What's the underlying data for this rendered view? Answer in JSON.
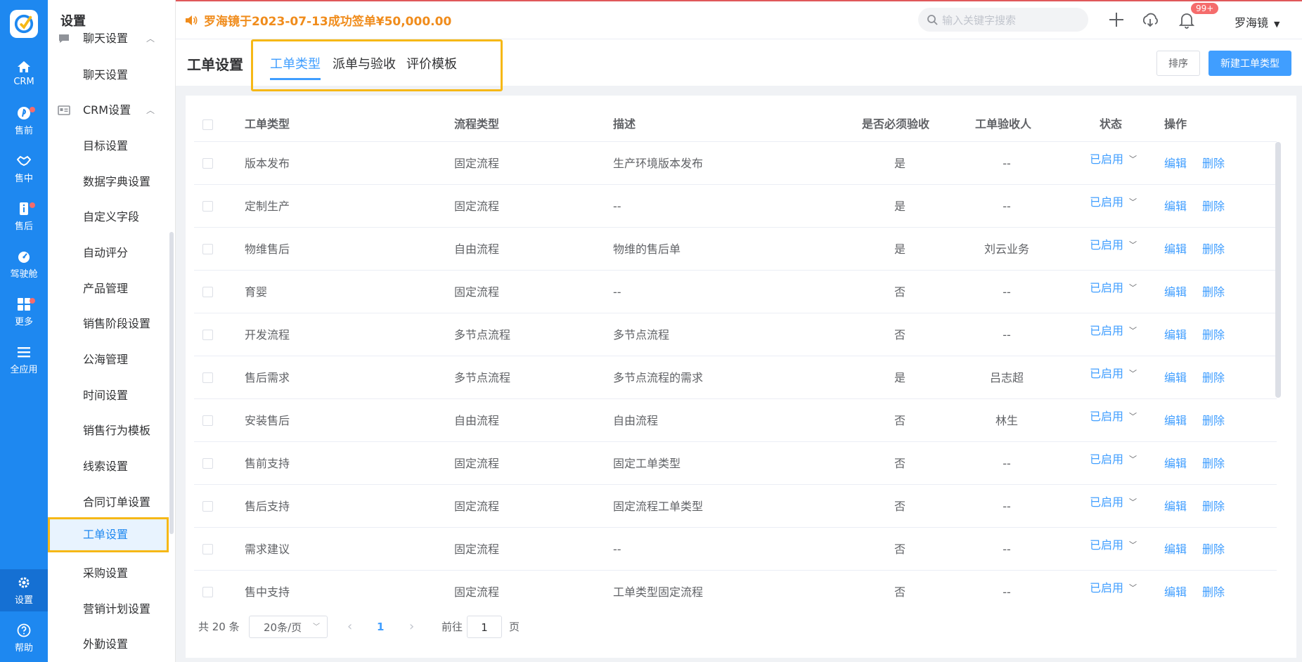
{
  "rail": {
    "items": [
      {
        "label": "CRM",
        "icon": "home-icon"
      },
      {
        "label": "售前",
        "icon": "pin-icon"
      },
      {
        "label": "售中",
        "icon": "handshake-icon"
      },
      {
        "label": "售后",
        "icon": "info-icon"
      },
      {
        "label": "驾驶舱",
        "icon": "dashboard-icon"
      },
      {
        "label": "更多",
        "icon": "grid-icon"
      },
      {
        "label": "全应用",
        "icon": "menu-icon"
      },
      {
        "label": "设置",
        "icon": "gear-icon"
      },
      {
        "label": "帮助",
        "icon": "help-icon"
      }
    ]
  },
  "sidebar": {
    "title": "设置",
    "items": [
      {
        "label": "聊天设置",
        "type": "group"
      },
      {
        "label": "聊天设置"
      },
      {
        "label": "CRM设置",
        "type": "group"
      },
      {
        "label": "目标设置"
      },
      {
        "label": "数据字典设置"
      },
      {
        "label": "自定义字段"
      },
      {
        "label": "自动评分"
      },
      {
        "label": "产品管理"
      },
      {
        "label": "销售阶段设置"
      },
      {
        "label": "公海管理"
      },
      {
        "label": "时间设置"
      },
      {
        "label": "销售行为模板"
      },
      {
        "label": "线索设置"
      },
      {
        "label": "合同订单设置"
      },
      {
        "label": "工单设置",
        "active": true
      },
      {
        "label": "采购设置"
      },
      {
        "label": "营销计划设置"
      },
      {
        "label": "外勤设置"
      }
    ]
  },
  "topbar": {
    "notice": "罗海镜于2023-07-13成功签单¥50,000.00",
    "search_placeholder": "输入关键字搜索",
    "badge": "99+",
    "user": "罗海镜"
  },
  "page": {
    "title": "工单设置",
    "tabs": [
      "工单类型",
      "派单与验收",
      "评价模板"
    ],
    "sort_label": "排序",
    "new_label": "新建工单类型"
  },
  "table": {
    "headers": [
      "工单类型",
      "流程类型",
      "描述",
      "是否必须验收",
      "工单验收人",
      "状态",
      "操作"
    ],
    "edit_label": "编辑",
    "delete_label": "删除",
    "rows": [
      {
        "type": "版本发布",
        "flow": "固定流程",
        "desc": "生产环境版本发布",
        "must": "是",
        "acceptor": "--",
        "status": "已启用"
      },
      {
        "type": "定制生产",
        "flow": "固定流程",
        "desc": "--",
        "must": "是",
        "acceptor": "--",
        "status": "已启用"
      },
      {
        "type": "物维售后",
        "flow": "自由流程",
        "desc": "物维的售后单",
        "must": "是",
        "acceptor": "刘云业务",
        "status": "已启用"
      },
      {
        "type": "育婴",
        "flow": "固定流程",
        "desc": "--",
        "must": "否",
        "acceptor": "--",
        "status": "已启用"
      },
      {
        "type": "开发流程",
        "flow": "多节点流程",
        "desc": "多节点流程",
        "must": "否",
        "acceptor": "--",
        "status": "已启用"
      },
      {
        "type": "售后需求",
        "flow": "多节点流程",
        "desc": "多节点流程的需求",
        "must": "是",
        "acceptor": "吕志超",
        "status": "已启用"
      },
      {
        "type": "安装售后",
        "flow": "自由流程",
        "desc": "自由流程",
        "must": "否",
        "acceptor": "林生",
        "status": "已启用"
      },
      {
        "type": "售前支持",
        "flow": "固定流程",
        "desc": "固定工单类型",
        "must": "否",
        "acceptor": "--",
        "status": "已启用"
      },
      {
        "type": "售后支持",
        "flow": "固定流程",
        "desc": "固定流程工单类型",
        "must": "否",
        "acceptor": "--",
        "status": "已启用"
      },
      {
        "type": "需求建议",
        "flow": "固定流程",
        "desc": "--",
        "must": "否",
        "acceptor": "--",
        "status": "已启用"
      },
      {
        "type": "售中支持",
        "flow": "固定流程",
        "desc": "工单类型固定流程",
        "must": "否",
        "acceptor": "--",
        "status": "已启用"
      }
    ]
  },
  "pager": {
    "total": "共 20 条",
    "page_size": "20条/页",
    "current": "1",
    "goto_prefix": "前往",
    "goto_value": "1",
    "goto_suffix": "页"
  },
  "colors": {
    "primary": "#1e88f0",
    "link": "#409eff",
    "notice": "#f08c1c",
    "highlight": "#f6b816",
    "badge": "#f56c6c"
  }
}
